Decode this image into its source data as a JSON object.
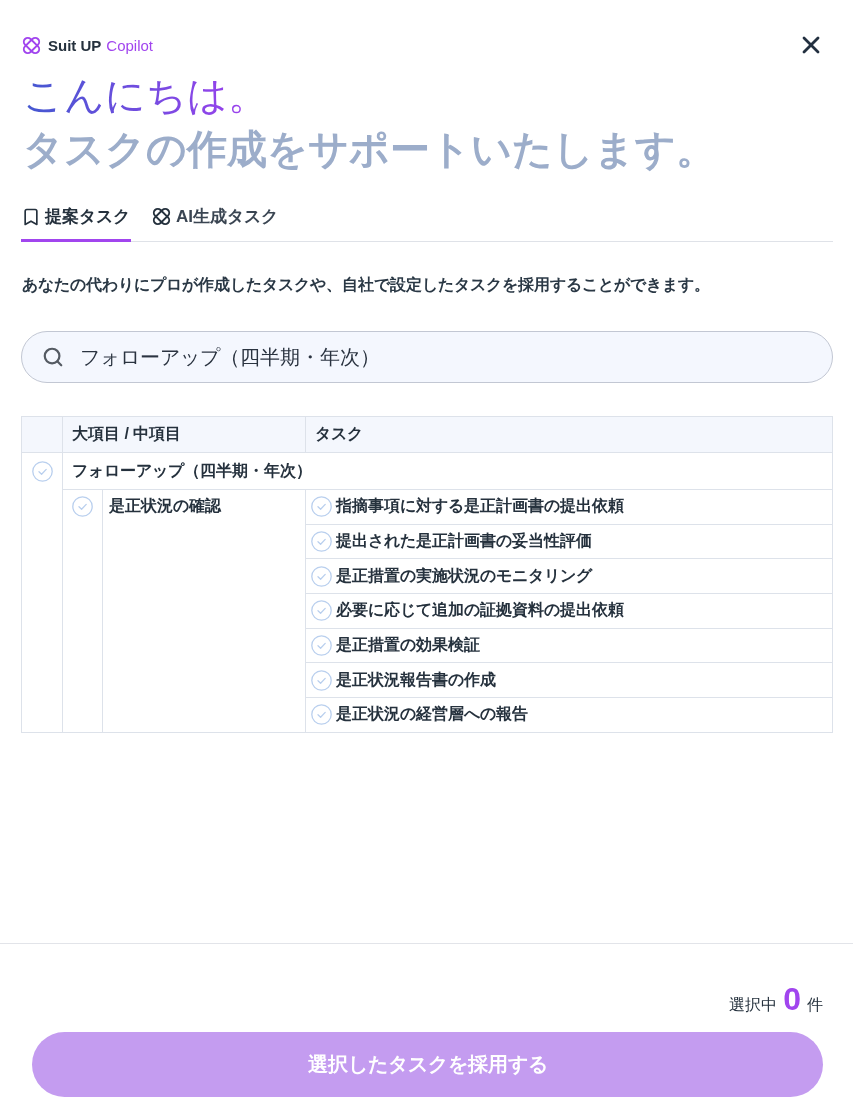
{
  "header": {
    "brand": "Suit UP",
    "product": "Copilot"
  },
  "greeting": "こんにちは。",
  "subtitle": "タスクの作成をサポートいたします。",
  "tabs": [
    {
      "label": "提案タスク",
      "selected": true
    },
    {
      "label": "AI生成タスク",
      "selected": false
    }
  ],
  "description": "あなたの代わりにプロが作成したタスクや、自社で設定したタスクを採用することができます。",
  "search": {
    "value": "フォローアップ（四半期・年次）"
  },
  "table": {
    "columns": [
      "大項目 / 中項目",
      "タスク"
    ],
    "groups": [
      {
        "name": "フォローアップ（四半期・年次）",
        "checked": false,
        "children": [
          {
            "name": "是正状況の確認",
            "checked": false,
            "tasks": [
              {
                "name": "指摘事項に対する是正計画書の提出依頼",
                "checked": false
              },
              {
                "name": "提出された是正計画書の妥当性評価",
                "checked": false
              },
              {
                "name": "是正措置の実施状況のモニタリング",
                "checked": false
              },
              {
                "name": "必要に応じて追加の証拠資料の提出依頼",
                "checked": false
              },
              {
                "name": "是正措置の効果検証",
                "checked": false
              },
              {
                "name": "是正状況報告書の作成",
                "checked": false
              },
              {
                "name": "是正状況の経営層への報告",
                "checked": false
              }
            ]
          }
        ]
      }
    ]
  },
  "footer": {
    "selected_label": "選択中",
    "count": "0",
    "unit": "件",
    "button": {
      "label": "選択したタスクを採用する",
      "disabled": true
    }
  }
}
